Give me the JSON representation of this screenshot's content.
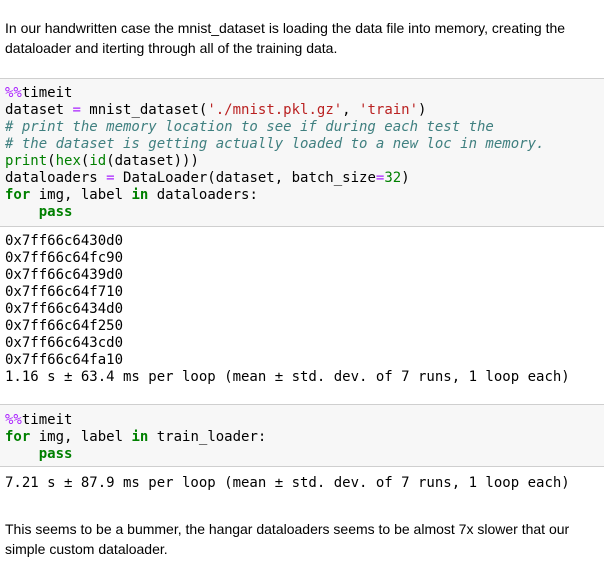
{
  "intro_text": "In our handwritten case the mnist_dataset is loading the data file into memory, creating the dataloader and iterting through all of the training data.",
  "cell1": {
    "line1": [
      "%%",
      "timeit"
    ],
    "line2": [
      "dataset ",
      "=",
      " mnist_dataset(",
      "'./mnist.pkl.gz'",
      ", ",
      "'train'",
      ")"
    ],
    "line3": "# print the memory location to see if during each test the",
    "line4": "# the dataset is getting actually loaded to a new loc in memory.",
    "line5": [
      "print",
      "(",
      "hex",
      "(",
      "id",
      "(dataset)))"
    ],
    "line6": [
      "dataloaders ",
      "=",
      " DataLoader(dataset, batch_size",
      "=",
      "32",
      ")"
    ],
    "line7": [
      "for",
      " img, label ",
      "in",
      " dataloaders:"
    ],
    "line8": [
      "    ",
      "pass"
    ]
  },
  "output1": [
    "0x7ff66c6430d0",
    "0x7ff66c64fc90",
    "0x7ff66c6439d0",
    "0x7ff66c64f710",
    "0x7ff66c6434d0",
    "0x7ff66c64f250",
    "0x7ff66c643cd0",
    "0x7ff66c64fa10",
    "1.16 s ± 63.4 ms per loop (mean ± std. dev. of 7 runs, 1 loop each)"
  ],
  "cell2": {
    "line1": [
      "%%",
      "timeit"
    ],
    "line2": [
      "for",
      " img, label ",
      "in",
      " train_loader:"
    ],
    "line3": [
      "    ",
      "pass"
    ]
  },
  "output2": [
    "7.21 s ± 87.9 ms per loop (mean ± std. dev. of 7 runs, 1 loop each)"
  ],
  "outro_text": "This seems to be a bummer, the hangar dataloaders seems to be almost 7x slower that our simple custom dataloader."
}
